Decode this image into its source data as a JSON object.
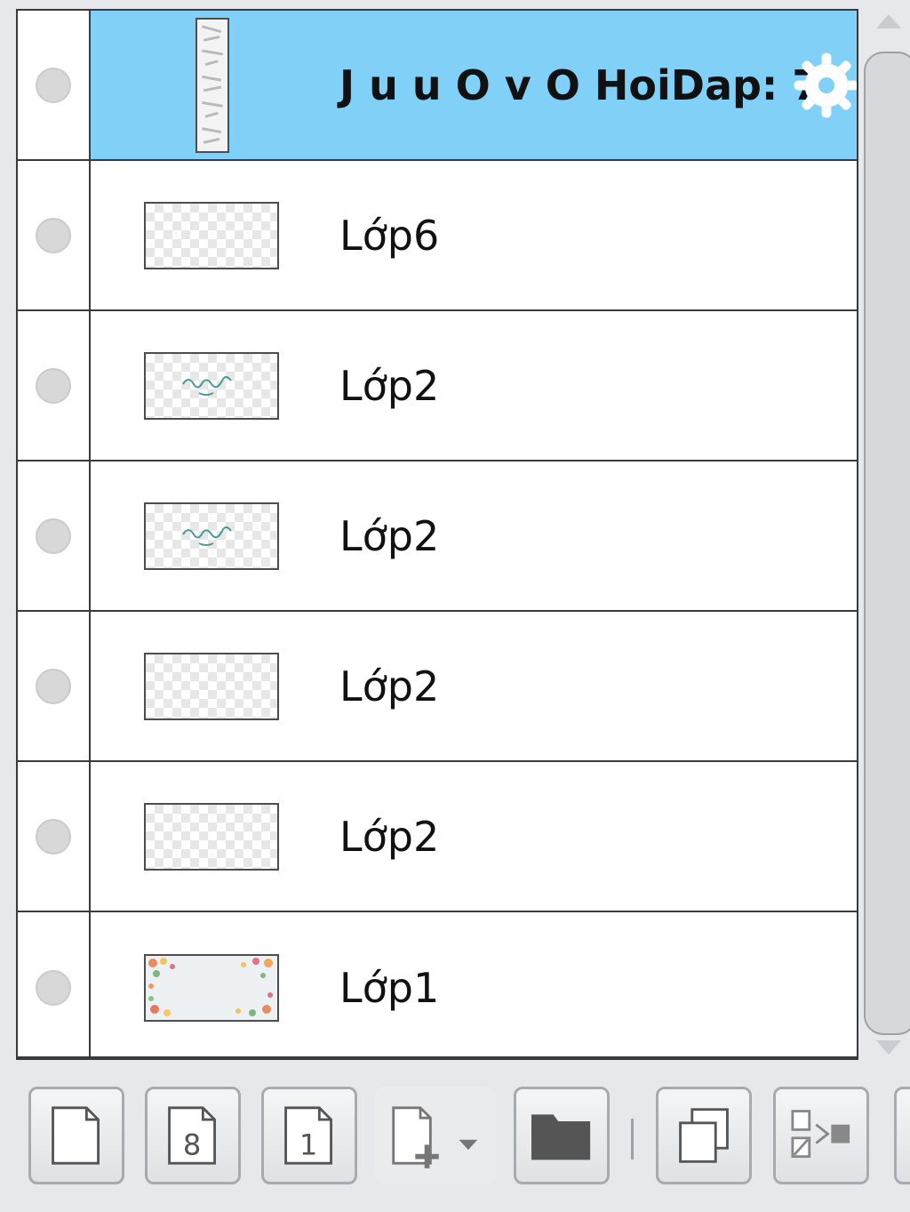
{
  "layers": [
    {
      "name": "J u u O v O HoiDap: 7",
      "selected": true,
      "thumb": "tall",
      "thumb_icon": "layer-thumbnail-icon"
    },
    {
      "name": "Lớp6",
      "selected": false,
      "thumb": "blank",
      "thumb_icon": "layer-thumbnail-icon"
    },
    {
      "name": "Lớp2",
      "selected": false,
      "thumb": "text",
      "thumb_icon": "layer-thumbnail-icon"
    },
    {
      "name": "Lớp2",
      "selected": false,
      "thumb": "text",
      "thumb_icon": "layer-thumbnail-icon"
    },
    {
      "name": "Lớp2",
      "selected": false,
      "thumb": "blank",
      "thumb_icon": "layer-thumbnail-icon"
    },
    {
      "name": "Lớp2",
      "selected": false,
      "thumb": "blank",
      "thumb_icon": "layer-thumbnail-icon"
    },
    {
      "name": "Lớp1",
      "selected": false,
      "thumb": "flowers",
      "thumb_icon": "layer-thumbnail-icon"
    }
  ],
  "selected_marker_icon": "gear-icon",
  "toolbar": {
    "buttons": [
      {
        "icon": "new-layer-icon",
        "label": ""
      },
      {
        "icon": "new-8bit-layer-icon",
        "label": "8"
      },
      {
        "icon": "new-1bit-layer-icon",
        "label": "1"
      },
      {
        "icon": "add-layer-dropdown-icon",
        "label": ""
      },
      {
        "icon": "new-folder-icon",
        "label": ""
      },
      {
        "icon": "duplicate-layer-icon",
        "label": ""
      },
      {
        "icon": "merge-layer-icon",
        "label": ""
      }
    ]
  },
  "colors": {
    "selected_row": "#80d0f7",
    "panel_bg": "#e6e8eb",
    "border": "#3a3a3a"
  }
}
